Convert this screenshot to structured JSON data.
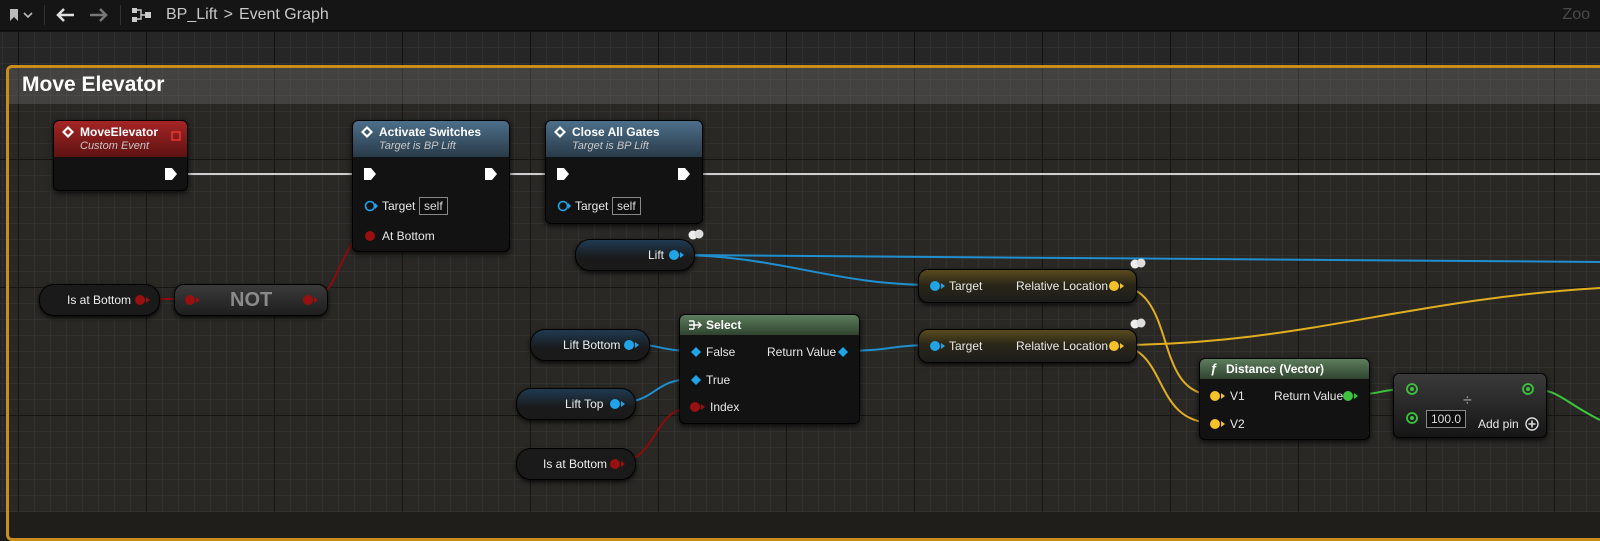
{
  "toolbar": {
    "breadcrumb_blueprint": "BP_Lift",
    "breadcrumb_separator": ">",
    "breadcrumb_graph": "Event Graph",
    "zoom_label": "Zoo"
  },
  "comment": {
    "title": "Move Elevator"
  },
  "nodes": {
    "move_elevator": {
      "title": "MoveElevator",
      "subtitle": "Custom Event"
    },
    "activate_switches": {
      "title": "Activate Switches",
      "subtitle": "Target is BP Lift",
      "target_label": "Target",
      "target_value": "self",
      "at_bottom_label": "At Bottom"
    },
    "close_all_gates": {
      "title": "Close All Gates",
      "subtitle": "Target is BP Lift",
      "target_label": "Target",
      "target_value": "self"
    },
    "is_at_bottom_1": {
      "label": "Is at Bottom"
    },
    "not_node": {
      "label": "NOT"
    },
    "lift_var": {
      "label": "Lift"
    },
    "get_rel_loc_1": {
      "target_label": "Target",
      "output_label": "Relative Location"
    },
    "get_rel_loc_2": {
      "target_label": "Target",
      "output_label": "Relative Location"
    },
    "select": {
      "title": "Select",
      "false_label": "False",
      "true_label": "True",
      "index_label": "Index",
      "return_label": "Return Value"
    },
    "lift_bottom": {
      "label": "Lift Bottom"
    },
    "lift_top": {
      "label": "Lift Top"
    },
    "is_at_bottom_2": {
      "label": "Is at Bottom"
    },
    "distance": {
      "title": "Distance (Vector)",
      "v1_label": "V1",
      "v2_label": "V2",
      "return_label": "Return Value"
    },
    "divide": {
      "value": "100.0",
      "add_pin_label": "Add pin",
      "symbol": "÷"
    }
  },
  "colors": {
    "exec_wire": "#d8d8d8",
    "object_pin": "#1fa4e8",
    "vector_pin": "#f6c22a",
    "bool_pin": "#9a0f0f",
    "float_pin": "#3cc43c",
    "comment_border": "#c98d1c",
    "event_header": "#8b1d1d",
    "function_header": "#3b5a72",
    "pure_header": "#3d5a3d"
  },
  "icons": [
    "bookmark-icon",
    "back-arrow-icon",
    "forward-arrow-icon",
    "graph-icon"
  ]
}
